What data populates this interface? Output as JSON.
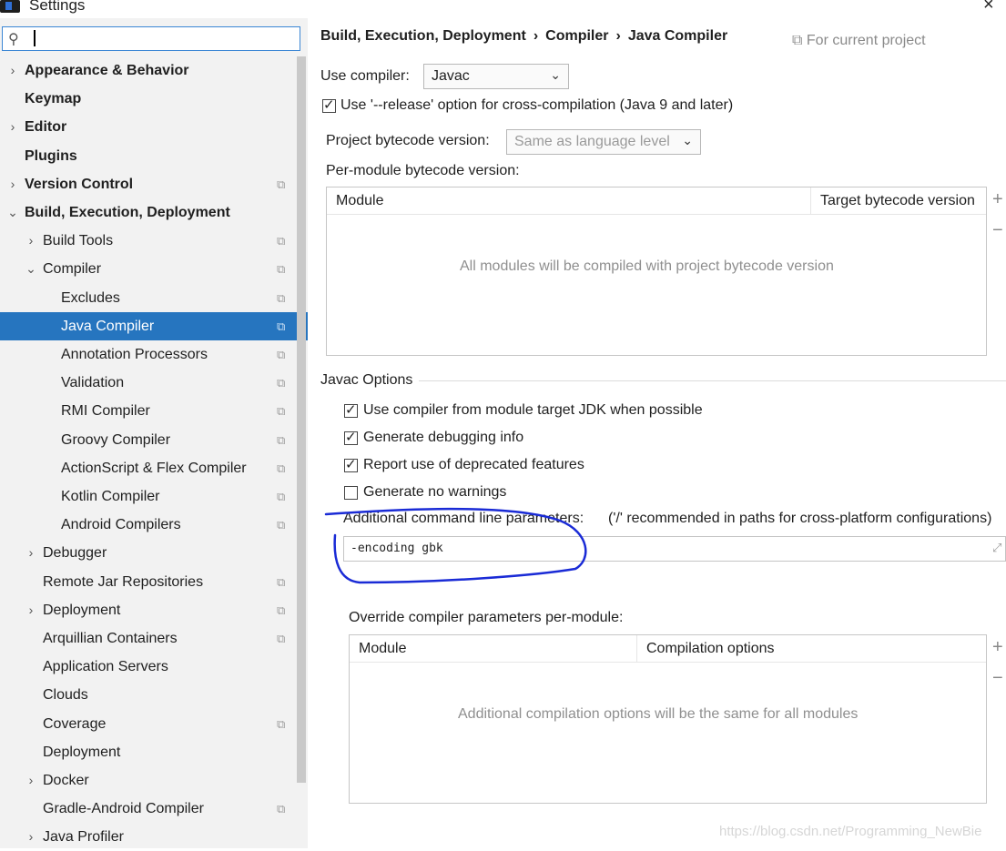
{
  "window": {
    "title": "Settings",
    "close_icon": "×"
  },
  "sidebar": {
    "search": {
      "value": "",
      "icon": "search-icon"
    },
    "items": [
      {
        "label": "Appearance & Behavior",
        "bold": true,
        "arrow": "›",
        "indent": 0,
        "project": false
      },
      {
        "label": "Keymap",
        "bold": true,
        "arrow": "",
        "indent": 0,
        "project": false
      },
      {
        "label": "Editor",
        "bold": true,
        "arrow": "›",
        "indent": 0,
        "project": false
      },
      {
        "label": "Plugins",
        "bold": true,
        "arrow": "",
        "indent": 0,
        "project": false
      },
      {
        "label": "Version Control",
        "bold": true,
        "arrow": "›",
        "indent": 0,
        "project": true
      },
      {
        "label": "Build, Execution, Deployment",
        "bold": true,
        "arrow": "⌄",
        "indent": 0,
        "project": false
      },
      {
        "label": "Build Tools",
        "bold": false,
        "arrow": "›",
        "indent": 1,
        "project": true
      },
      {
        "label": "Compiler",
        "bold": false,
        "arrow": "⌄",
        "indent": 1,
        "project": true
      },
      {
        "label": "Excludes",
        "bold": false,
        "arrow": "",
        "indent": 2,
        "project": true
      },
      {
        "label": "Java Compiler",
        "bold": false,
        "arrow": "",
        "indent": 2,
        "project": true,
        "selected": true
      },
      {
        "label": "Annotation Processors",
        "bold": false,
        "arrow": "",
        "indent": 2,
        "project": true
      },
      {
        "label": "Validation",
        "bold": false,
        "arrow": "",
        "indent": 2,
        "project": true
      },
      {
        "label": "RMI Compiler",
        "bold": false,
        "arrow": "",
        "indent": 2,
        "project": true
      },
      {
        "label": "Groovy Compiler",
        "bold": false,
        "arrow": "",
        "indent": 2,
        "project": true
      },
      {
        "label": "ActionScript & Flex Compiler",
        "bold": false,
        "arrow": "",
        "indent": 2,
        "project": true
      },
      {
        "label": "Kotlin Compiler",
        "bold": false,
        "arrow": "",
        "indent": 2,
        "project": true
      },
      {
        "label": "Android Compilers",
        "bold": false,
        "arrow": "",
        "indent": 2,
        "project": true
      },
      {
        "label": "Debugger",
        "bold": false,
        "arrow": "›",
        "indent": 1,
        "project": false
      },
      {
        "label": "Remote Jar Repositories",
        "bold": false,
        "arrow": "",
        "indent": 1,
        "project": true
      },
      {
        "label": "Deployment",
        "bold": false,
        "arrow": "›",
        "indent": 1,
        "project": true
      },
      {
        "label": "Arquillian Containers",
        "bold": false,
        "arrow": "",
        "indent": 1,
        "project": true
      },
      {
        "label": "Application Servers",
        "bold": false,
        "arrow": "",
        "indent": 1,
        "project": false
      },
      {
        "label": "Clouds",
        "bold": false,
        "arrow": "",
        "indent": 1,
        "project": false
      },
      {
        "label": "Coverage",
        "bold": false,
        "arrow": "",
        "indent": 1,
        "project": true
      },
      {
        "label": "Deployment",
        "bold": false,
        "arrow": "",
        "indent": 1,
        "project": false
      },
      {
        "label": "Docker",
        "bold": false,
        "arrow": "›",
        "indent": 1,
        "project": false
      },
      {
        "label": "Gradle-Android Compiler",
        "bold": false,
        "arrow": "",
        "indent": 1,
        "project": true
      },
      {
        "label": "Java Profiler",
        "bold": false,
        "arrow": "›",
        "indent": 1,
        "project": false
      }
    ]
  },
  "breadcrumb": [
    "Build, Execution, Deployment",
    "Compiler",
    "Java Compiler"
  ],
  "for_current_project": "For current project",
  "use_compiler": {
    "label": "Use compiler:",
    "value": "Javac"
  },
  "release_option": {
    "label": "Use '--release' option for cross-compilation (Java 9 and later)",
    "checked": true
  },
  "project_bytecode": {
    "label": "Project bytecode version:",
    "placeholder": "Same as language level"
  },
  "per_module": {
    "label": "Per-module bytecode version:",
    "columns": [
      "Module",
      "Target bytecode version"
    ],
    "empty_text": "All modules will be compiled with project bytecode version"
  },
  "javac_options": {
    "title": "Javac Options",
    "checkboxes": [
      {
        "label": "Use compiler from module target JDK when possible",
        "checked": true
      },
      {
        "label": "Generate debugging info",
        "checked": true
      },
      {
        "label": "Report use of deprecated features",
        "checked": true
      },
      {
        "label": "Generate no warnings",
        "checked": false
      }
    ],
    "cmd_label": "Additional command line parameters:",
    "cmd_hint": "('/' recommended in paths for cross-platform configurations)",
    "cmd_value": "-encoding gbk"
  },
  "override": {
    "label": "Override compiler parameters per-module:",
    "columns": [
      "Module",
      "Compilation options"
    ],
    "empty_text": "Additional compilation options will be the same for all modules"
  },
  "table_buttons": {
    "add": "+",
    "remove": "−"
  },
  "watermark": "https://blog.csdn.net/Programming_NewBie",
  "colors": {
    "selection": "#2675bf",
    "annotation": "#1a2bd6",
    "focus_border": "#3b86d4"
  }
}
